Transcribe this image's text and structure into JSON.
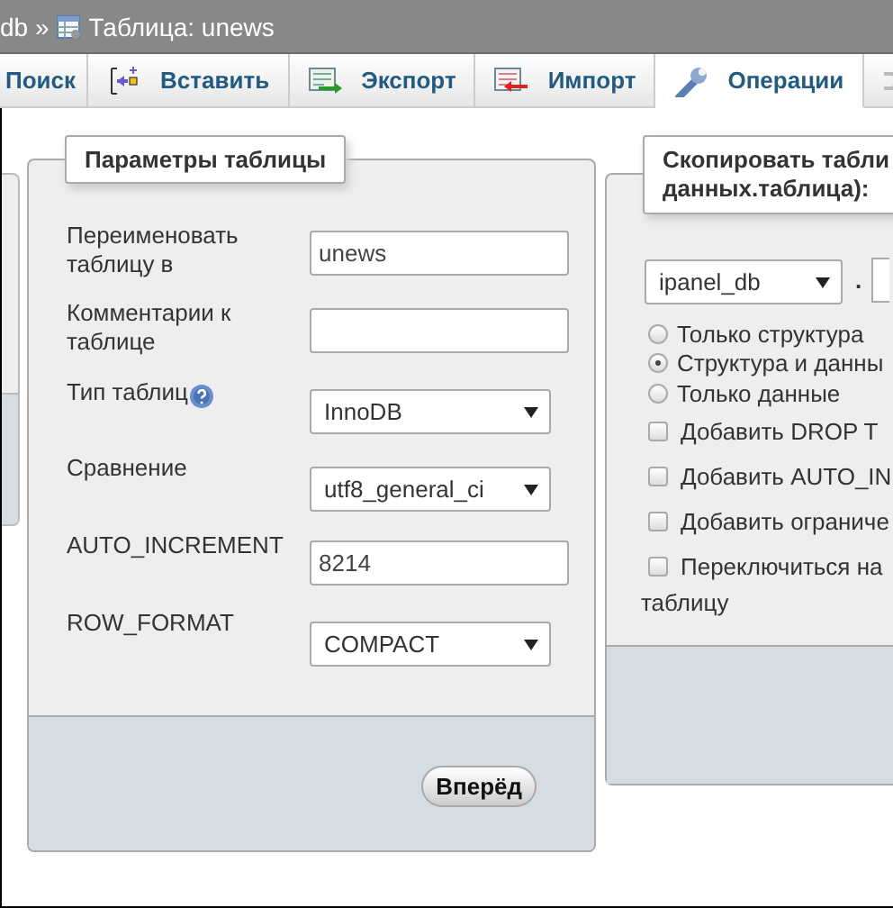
{
  "breadcrumb": {
    "prefix": "db »",
    "title": "Таблица: unews"
  },
  "tabs": [
    {
      "label": "Поиск",
      "selected": false
    },
    {
      "label": "Вставить",
      "selected": false
    },
    {
      "label": "Экспорт",
      "selected": false
    },
    {
      "label": "Импорт",
      "selected": false
    },
    {
      "label": "Операции",
      "selected": true
    },
    {
      "selected": false
    }
  ],
  "table_options": {
    "legend": "Параметры таблицы",
    "rows": [
      {
        "kind": "text",
        "label": "Переименовать таблицу в",
        "value": "unews",
        "help": false
      },
      {
        "kind": "text",
        "label": "Комментарии к таблице",
        "value": "",
        "help": false
      },
      {
        "kind": "select",
        "label": "Тип таблиц",
        "value": "InnoDB",
        "help": true
      },
      {
        "kind": "select",
        "label": "Сравнение",
        "value": "utf8_general_ci",
        "help": false
      },
      {
        "kind": "text",
        "label": "AUTO_INCREMENT",
        "value": "8214",
        "help": false
      },
      {
        "kind": "select",
        "label": "ROW_FORMAT",
        "value": "COMPACT",
        "help": false
      }
    ],
    "button": "Вперёд"
  },
  "copy_table": {
    "legend_lines": [
      "Скопировать табли",
      "данных.таблица):"
    ],
    "database": "ipanel_db",
    "separator": ".",
    "options": [
      {
        "kind": "radio",
        "label": "Только структура",
        "selected": false
      },
      {
        "kind": "radio",
        "label": "Структура и данны",
        "selected": true
      },
      {
        "kind": "radio",
        "label": "Только данные",
        "selected": false
      },
      {
        "kind": "checkbox",
        "label": "Добавить DROP T",
        "checked": false
      },
      {
        "kind": "checkbox",
        "label": "Добавить AUTO_IN",
        "checked": false
      },
      {
        "kind": "checkbox",
        "label": "Добавить ограниче",
        "checked": false
      },
      {
        "kind": "checkbox",
        "label": "Переключиться на",
        "checked": false,
        "continuation": "таблицу"
      }
    ]
  }
}
